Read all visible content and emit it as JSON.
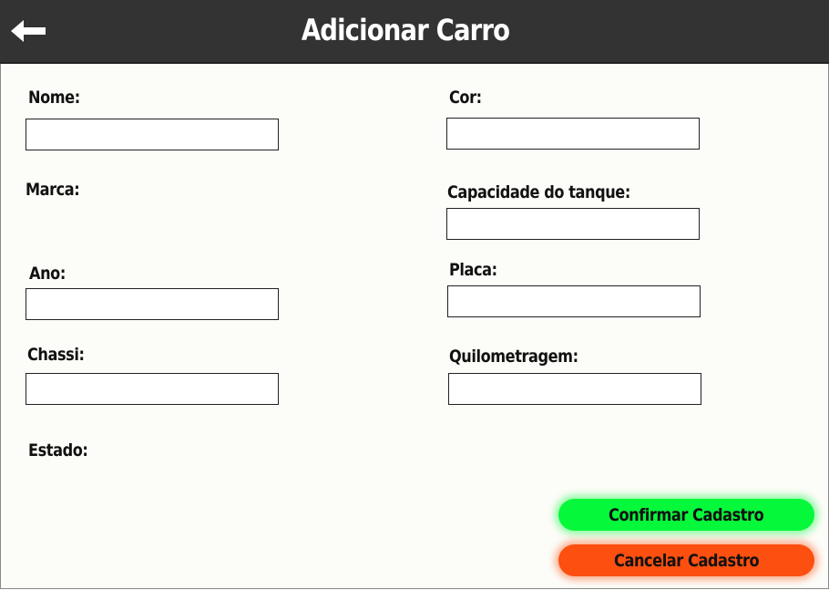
{
  "header": {
    "title": "Adicionar Carro",
    "back_icon": "arrow-left-icon"
  },
  "form": {
    "nome_label": "Nome:",
    "marca_label": "Marca:",
    "ano_label": "Ano:",
    "chassi_label": "Chassi:",
    "estado_label": "Estado:",
    "cor_label": "Cor:",
    "capacidade_label": "Capacidade do tanque:",
    "placa_label": "Placa:",
    "quilometragem_label": "Quilometragem:",
    "values": {
      "nome": "",
      "ano": "",
      "chassi": "",
      "cor": "",
      "capacidade": "",
      "placa": "",
      "quilometragem": ""
    }
  },
  "actions": {
    "confirm_label": "Confirmar Cadastro",
    "cancel_label": "Cancelar Cadastro"
  },
  "colors": {
    "header_bg": "#333333",
    "page_bg": "#fcfcf8",
    "confirm": "#06f83a",
    "cancel": "#fc4f10"
  }
}
